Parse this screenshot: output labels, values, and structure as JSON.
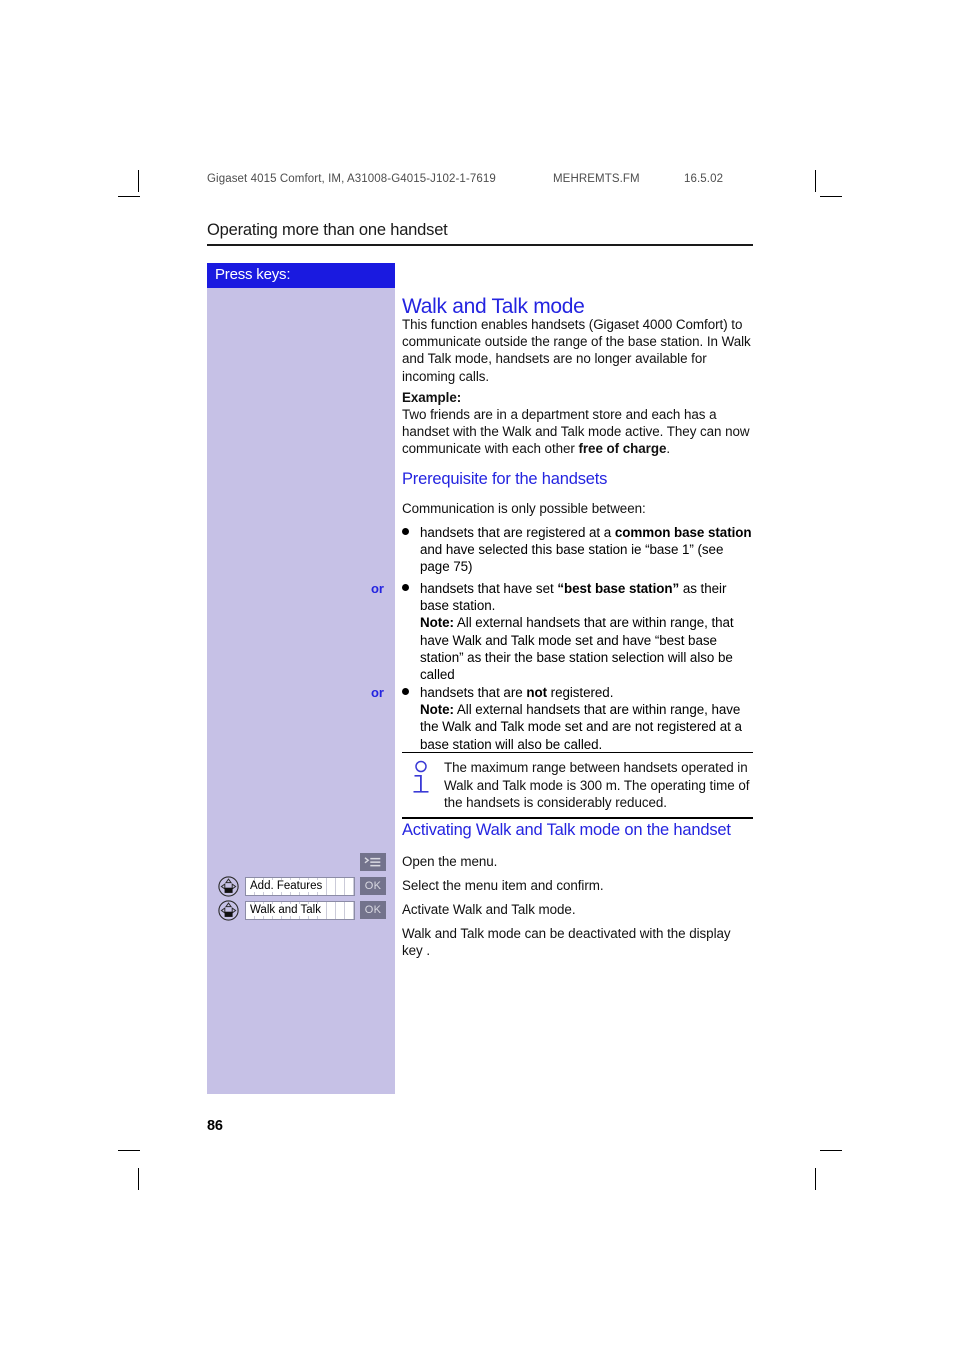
{
  "running_head": {
    "document": "Gigaset 4015 Comfort, IM, A31008-G4015-J102-1-7619",
    "filename": "MEHREMTS.FM",
    "date": "16.5.02"
  },
  "chapter_title": "Operating more than one handset",
  "page_number": "86",
  "colors": {
    "heading_blue": "#2424e0",
    "sidebar_header_blue": "#1a1ae0",
    "sidebar_lavender": "#c6c1e6",
    "key_gray": "#73738c",
    "key_label_gray": "#d9d9e2"
  },
  "sidebar": {
    "header_label": "Press keys:",
    "key_rows": [
      {
        "id": "menu",
        "nav_key": false,
        "field_value": "",
        "action_key": "menu-icon",
        "action_label": ""
      },
      {
        "id": "add-features",
        "nav_key": true,
        "field_value": "Add. Features",
        "action_key": "ok",
        "action_label": "OK"
      },
      {
        "id": "walk-and-talk",
        "nav_key": true,
        "field_value": "Walk and Talk",
        "action_key": "ok",
        "action_label": "OK"
      }
    ]
  },
  "main": {
    "h1_walk_and_talk": "Walk and Talk mode",
    "intro_paragraph": "This function enables handsets (Gigaset 4000 Comfort) to communicate outside the range of the base station. In Walk and Talk mode, handsets are no longer available for incoming calls.",
    "example_heading": "Example:",
    "example_paragraph": "Two friends are in a department store and each has a handset with the Walk and Talk mode active. They can now communicate with each other free of charge.",
    "example_bold_tail": "free of charge",
    "h2_prerequisite": "Prerequisite for the handsets",
    "communication_lead": "Communication is only possible between:",
    "or_label": "or",
    "bullets": [
      {
        "or": false,
        "text": "handsets that are registered at a common base station and have selected this base station ie “base 1” (see page 75)"
      },
      {
        "or": true,
        "text": "handsets that have set “best base station” as their base station. Note: All external handsets that are within range, that have Walk and Talk mode set and have “best base station” as their the base station selection will also be called"
      },
      {
        "or": true,
        "text": "handsets that are not registered. Note: All external handsets that are within range, have the Walk and Talk mode set and are not registered at a base station will also be called."
      }
    ],
    "note": {
      "icon": "info-icon",
      "text": "The maximum range between handsets operated in Walk and Talk mode is 300 m. The operating time of the handsets is considerably reduced."
    },
    "h2_activating": "Activating Walk and Talk mode on the handset",
    "steps": [
      "Open the menu.",
      "Select the menu item and confirm.",
      "Activate Walk and Talk mode."
    ],
    "closing_paragraph": "Walk and Talk mode can be deactivated with the display key ."
  }
}
